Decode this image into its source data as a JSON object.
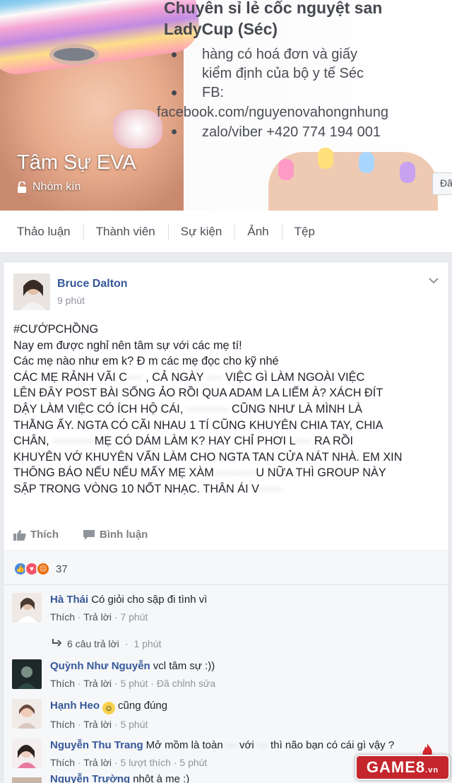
{
  "cover": {
    "title_line1": "Chuyên sỉ lẻ cốc nguyệt san",
    "title_line2": "LadyCup (Séc)",
    "bullet1_line1": "hàng có hoá đơn và giấy",
    "bullet1_line2": "kiểm định của bộ y tế Séc",
    "bullet2_label": "FB:",
    "facebook_url": "facebook.com/nguyenovahongnhung",
    "zalo": "zalo/viber +420 774 194 001",
    "side_button": "Đã"
  },
  "group": {
    "name": "Tâm Sự EVA",
    "privacy": "Nhóm kín"
  },
  "tabs": [
    {
      "label": "Thảo luận"
    },
    {
      "label": "Thành viên"
    },
    {
      "label": "Sự kiện"
    },
    {
      "label": "Ảnh"
    },
    {
      "label": "Tệp"
    }
  ],
  "post": {
    "author": "Bruce Dalton",
    "time": "9 phút",
    "hashtag": "#CƯỚPCHỒNG",
    "line1": "Nay em được nghỉ nên tâm sự với các mẹ tí!",
    "line2": "Các mẹ nào như em k? Đ m các mẹ đọc cho kỹ nhé",
    "line3a": "CÁC MẸ RẢNH VÃI C",
    "line3b": "···· ",
    "line3c": ", CẢ NGÀY ",
    "line3d": "····",
    "line3e": " VIỆC GÌ LÀM NGOÀI VIỆC",
    "line4": "LÊN ĐÂY POST BÀI SỐNG ẢO RỒI QUA ADAM LA LIẾM À? XÁCH ĐÍT",
    "line5a": "DẬY LÀM VIỆC CÓ ÍCH HỘ CÁI, ",
    "line5b": "··········· ",
    "line5c": " CŨNG NHƯ LÀ MÌNH LÀ",
    "line6": "THẰNG ẤY. NGTA CÓ CÃI NHAU 1 TÍ CŨNG KHUYÊN CHIA TAY, CHIA",
    "line7a": "CHÂN, ",
    "line7b": "···········",
    "line7c": "MẸ CÓ DÁM LÀM K? HAY CHỈ PHƠI L",
    "line7d": "····",
    "line7e": " RA RỒI",
    "line8": "KHUYÊN VỚ KHUYÊN VẨN LÀM CHO NGTA TAN CỬA NÁT NHÀ. EM XIN",
    "line9a": "THÔNG BÁO NẾU NẾU MẤY MẸ XÀM",
    "line9b": "···········",
    "line9c": "U NỮA THÌ GROUP NÀY",
    "line10a": "SẬP TRONG VÒNG 10 NỐT NHẠC. THÂN ÁI V",
    "line10b": "······"
  },
  "actions": {
    "like": "Thích",
    "comment": "Bình luận"
  },
  "reactions": {
    "count": "37",
    "colors": {
      "like": "#4a89dc",
      "love": "#f25268",
      "angry": "#e9710f"
    }
  },
  "comments": [
    {
      "name": "Hà Thái",
      "text": "Có giỏi cho sập đi tình vì",
      "like": "Thích",
      "reply": "Trả lời",
      "time": "7 phút"
    },
    {
      "name": "Quỳnh Như Nguyễn",
      "text": "vcl tâm sự :))",
      "like": "Thích",
      "reply": "Trả lời",
      "time": "5 phút",
      "extra": "Đã chỉnh sửa"
    },
    {
      "name": "Hạnh Heo",
      "text": "cũng đúng",
      "like": "Thích",
      "reply": "Trả lời",
      "time": "5 phút"
    },
    {
      "name": "Nguyễn Thu Trang",
      "text_a": "Mở mồm là toàn ",
      "text_b": "···",
      "text_c": " với ",
      "text_d": "···",
      "text_e": " thì não bạn có cái gì vậy ?",
      "like": "Thích",
      "reply": "Trả lời",
      "likes": "5 lượt thích",
      "time": "5 phút"
    },
    {
      "name": "Nguyễn Trường",
      "text": "nhột à mẹ :)"
    }
  ],
  "replies": {
    "label": "6 câu trả lời",
    "time": "1 phút"
  },
  "watermark": {
    "text": "GAME8",
    "suffix": ".vn"
  }
}
